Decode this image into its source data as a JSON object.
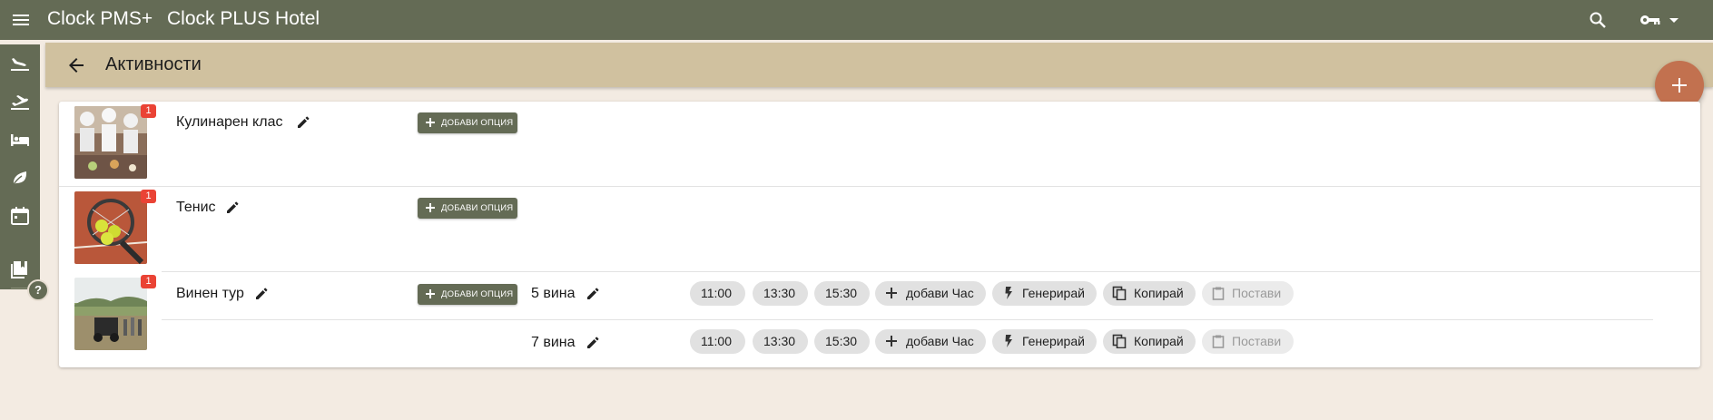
{
  "topbar": {
    "app_name": "Clock PMS+",
    "hotel_name": "Clock PLUS Hotel",
    "icons": [
      "menu-icon",
      "search-icon",
      "key-icon",
      "arrow-drop-down-icon"
    ]
  },
  "siderail": {
    "items": [
      {
        "icon": "flight-land-icon"
      },
      {
        "icon": "flight-takeoff-icon"
      },
      {
        "icon": "bed-icon"
      },
      {
        "icon": "leaf-icon"
      },
      {
        "icon": "calendar-icon"
      },
      {
        "icon": "book-icon"
      }
    ],
    "help_label": "?"
  },
  "header": {
    "title": "Активности",
    "back_icon": "arrow-back-icon"
  },
  "fab": {
    "label": "+",
    "color": "#c2714f"
  },
  "colors": {
    "primary": "#646b55",
    "header": "#d0c19f",
    "badge": "#ea4335",
    "background": "#f3ebe2"
  },
  "activities": [
    {
      "name": "Кулинарен клас",
      "badge": "1",
      "add_option_label": "ДОБАВИ ОПЦИЯ",
      "options": []
    },
    {
      "name": "Тенис",
      "badge": "1",
      "add_option_label": "ДОБАВИ ОПЦИЯ",
      "options": []
    },
    {
      "name": "Винен тур",
      "badge": "1",
      "add_option_label": "ДОБАВИ ОПЦИЯ",
      "options": [
        {
          "name": "5 вина",
          "times": [
            "11:00",
            "13:30",
            "15:30"
          ],
          "add_time_label": "добави Час",
          "generate_label": "Генерирай",
          "copy_label": "Копирай",
          "paste_label": "Постави"
        },
        {
          "name": "7 вина",
          "times": [
            "11:00",
            "13:30",
            "15:30"
          ],
          "add_time_label": "добави Час",
          "generate_label": "Генерирай",
          "copy_label": "Копирай",
          "paste_label": "Постави"
        }
      ]
    }
  ]
}
